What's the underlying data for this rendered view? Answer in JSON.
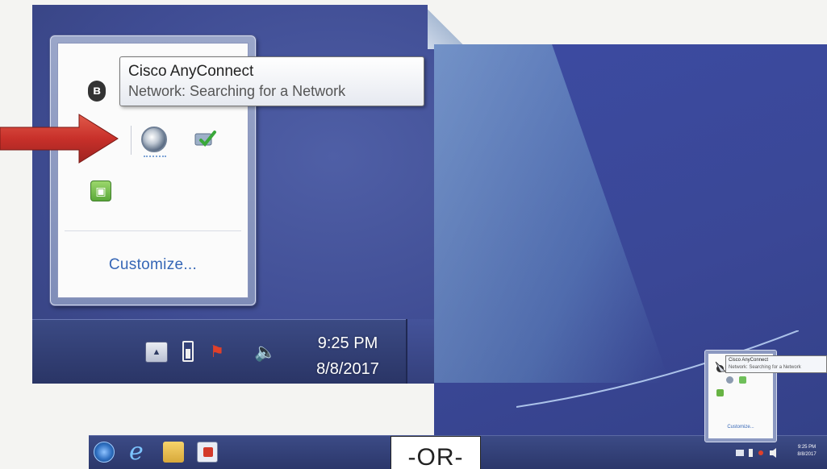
{
  "tooltip": {
    "title": "Cisco AnyConnect",
    "text": "Network: Searching for a Network"
  },
  "tray_popup": {
    "customize_label": "Customize..."
  },
  "taskbar": {
    "time": "9:25 PM",
    "date": "8/8/2017"
  },
  "separator_label": "-OR-",
  "mini_screenshot": {
    "tooltip_title": "Cisco AnyConnect",
    "tooltip_text": "Network: Searching for a Network",
    "customize_label": "Customize...",
    "time": "9:25 PM",
    "date": "8/8/2017"
  },
  "icons": {
    "bluetooth": "bluetooth-icon",
    "anyconnect": "cisco-anyconnect-icon",
    "network_monitor": "network-check-icon",
    "green_app": "green-app-icon",
    "show_hidden": "show-hidden-icons-icon",
    "battery": "battery-icon",
    "action_center": "action-center-icon",
    "volume": "volume-icon",
    "start": "start-orb-icon",
    "ie": "internet-explorer-icon",
    "explorer": "file-explorer-icon",
    "media": "media-player-icon"
  },
  "colors": {
    "arrow": "#c8302a",
    "desktop": "#3f4c93",
    "link": "#3566b6"
  }
}
